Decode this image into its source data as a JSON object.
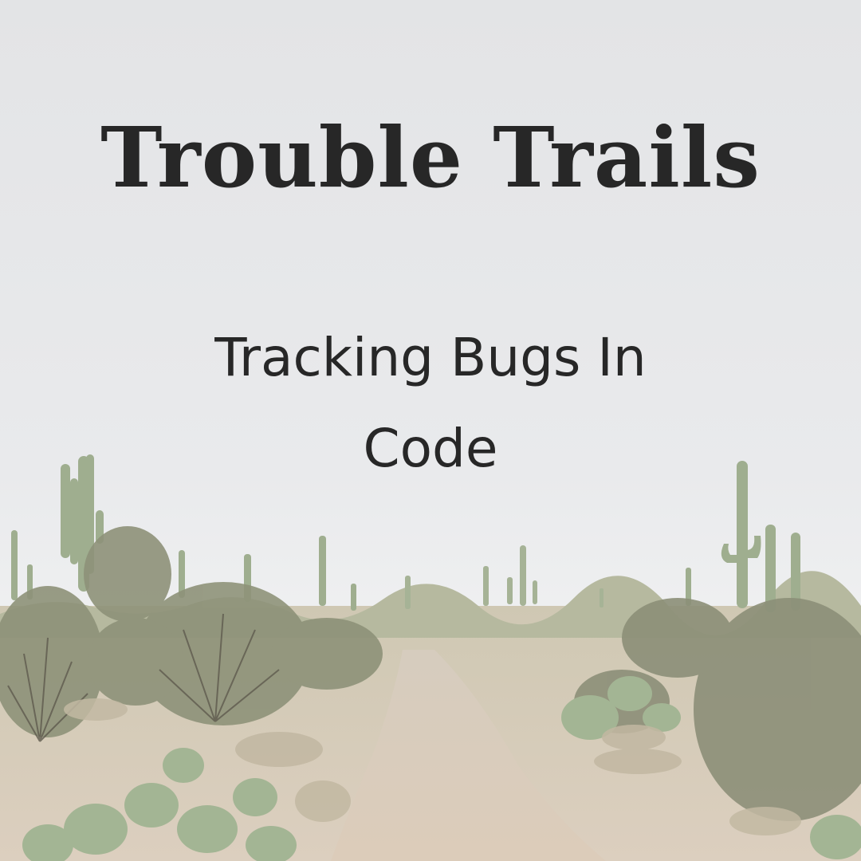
{
  "poster": {
    "title": "Trouble Trails",
    "subtitle": "Tracking Bugs In Code"
  },
  "photo": {
    "scene": "desert trail with saguaro cacti",
    "colors": {
      "sky": "#e6e7e9",
      "text": "#272727",
      "path": "#d8cab8",
      "cactus": "#a7b596",
      "brush": "#8d9178"
    }
  }
}
